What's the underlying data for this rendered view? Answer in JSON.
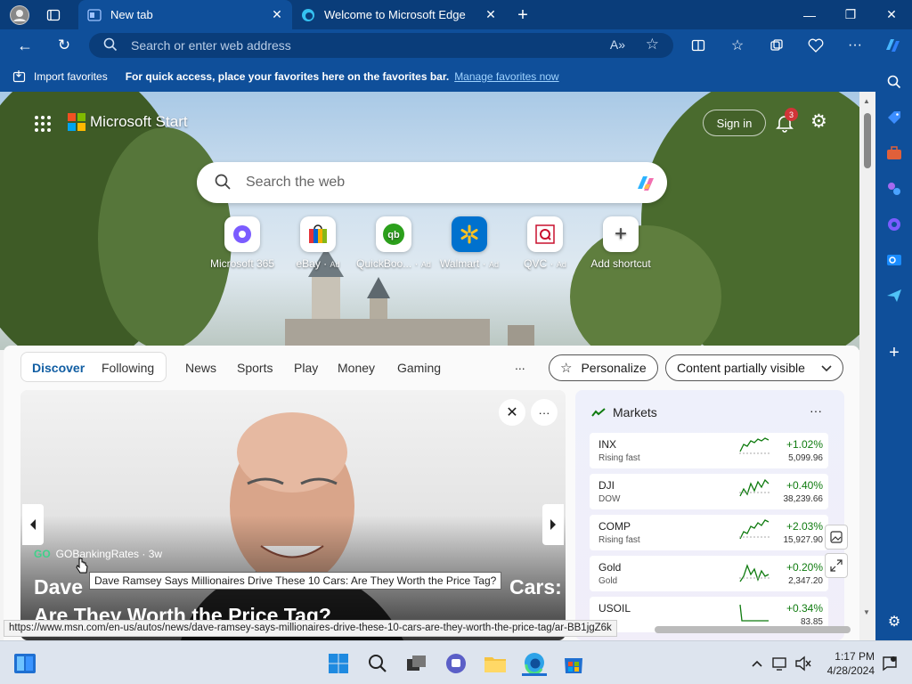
{
  "tabs": [
    {
      "label": "New tab"
    },
    {
      "label": "Welcome to Microsoft Edge"
    }
  ],
  "address": {
    "placeholder": "Search or enter web address"
  },
  "favbar": {
    "import": "Import favorites",
    "hint": "For quick access, place your favorites here on the favorites bar.",
    "manage": "Manage favorites now"
  },
  "brand": {
    "name": "Microsoft Start"
  },
  "signin": "Sign in",
  "notif_count": "3",
  "search": {
    "placeholder": "Search the web"
  },
  "quicklinks": [
    {
      "label": "Microsoft 365",
      "ad": ""
    },
    {
      "label": "eBay",
      "ad": "Ad"
    },
    {
      "label": "QuickBoo...",
      "ad": "Ad"
    },
    {
      "label": "Walmart",
      "ad": "Ad"
    },
    {
      "label": "QVC",
      "ad": "Ad"
    },
    {
      "label": "Add shortcut",
      "ad": ""
    }
  ],
  "feed": {
    "tabs": [
      "Discover",
      "Following"
    ],
    "nav": [
      "News",
      "Sports",
      "Play",
      "Money",
      "Gaming"
    ],
    "more": "...",
    "personalize": "Personalize",
    "visibility": "Content partially visible"
  },
  "article": {
    "source": "GOBankingRates · 3w",
    "source_badge": "GO",
    "title_line1": "Dave",
    "title_line1_end": "Cars:",
    "title_line2": "Are They Worth the Price Tag?",
    "tooltip": "Dave Ramsey Says Millionaires Drive These 10 Cars: Are They Worth the Price Tag?"
  },
  "markets": {
    "title": "Markets",
    "rows": [
      {
        "sym": "INX",
        "sub": "Rising fast",
        "chg": "+1.02%",
        "val": "5,099.96"
      },
      {
        "sym": "DJI",
        "sub": "DOW",
        "chg": "+0.40%",
        "val": "38,239.66"
      },
      {
        "sym": "COMP",
        "sub": "Rising fast",
        "chg": "+2.03%",
        "val": "15,927.90"
      },
      {
        "sym": "Gold",
        "sub": "Gold",
        "chg": "+0.20%",
        "val": "2,347.20"
      },
      {
        "sym": "USOIL",
        "sub": "",
        "chg": "+0.34%",
        "val": "83.85"
      }
    ]
  },
  "status_url": "https://www.msn.com/en-us/autos/news/dave-ramsey-says-millionaires-drive-these-10-cars-are-they-worth-the-price-tag/ar-BB1jgZ6k",
  "clock": {
    "time": "1:17 PM",
    "date": "4/28/2024"
  },
  "colors": {
    "edge_blue": "#0f4f9a",
    "market_green": "#0f7b0f",
    "link": "#9fd3ff"
  }
}
